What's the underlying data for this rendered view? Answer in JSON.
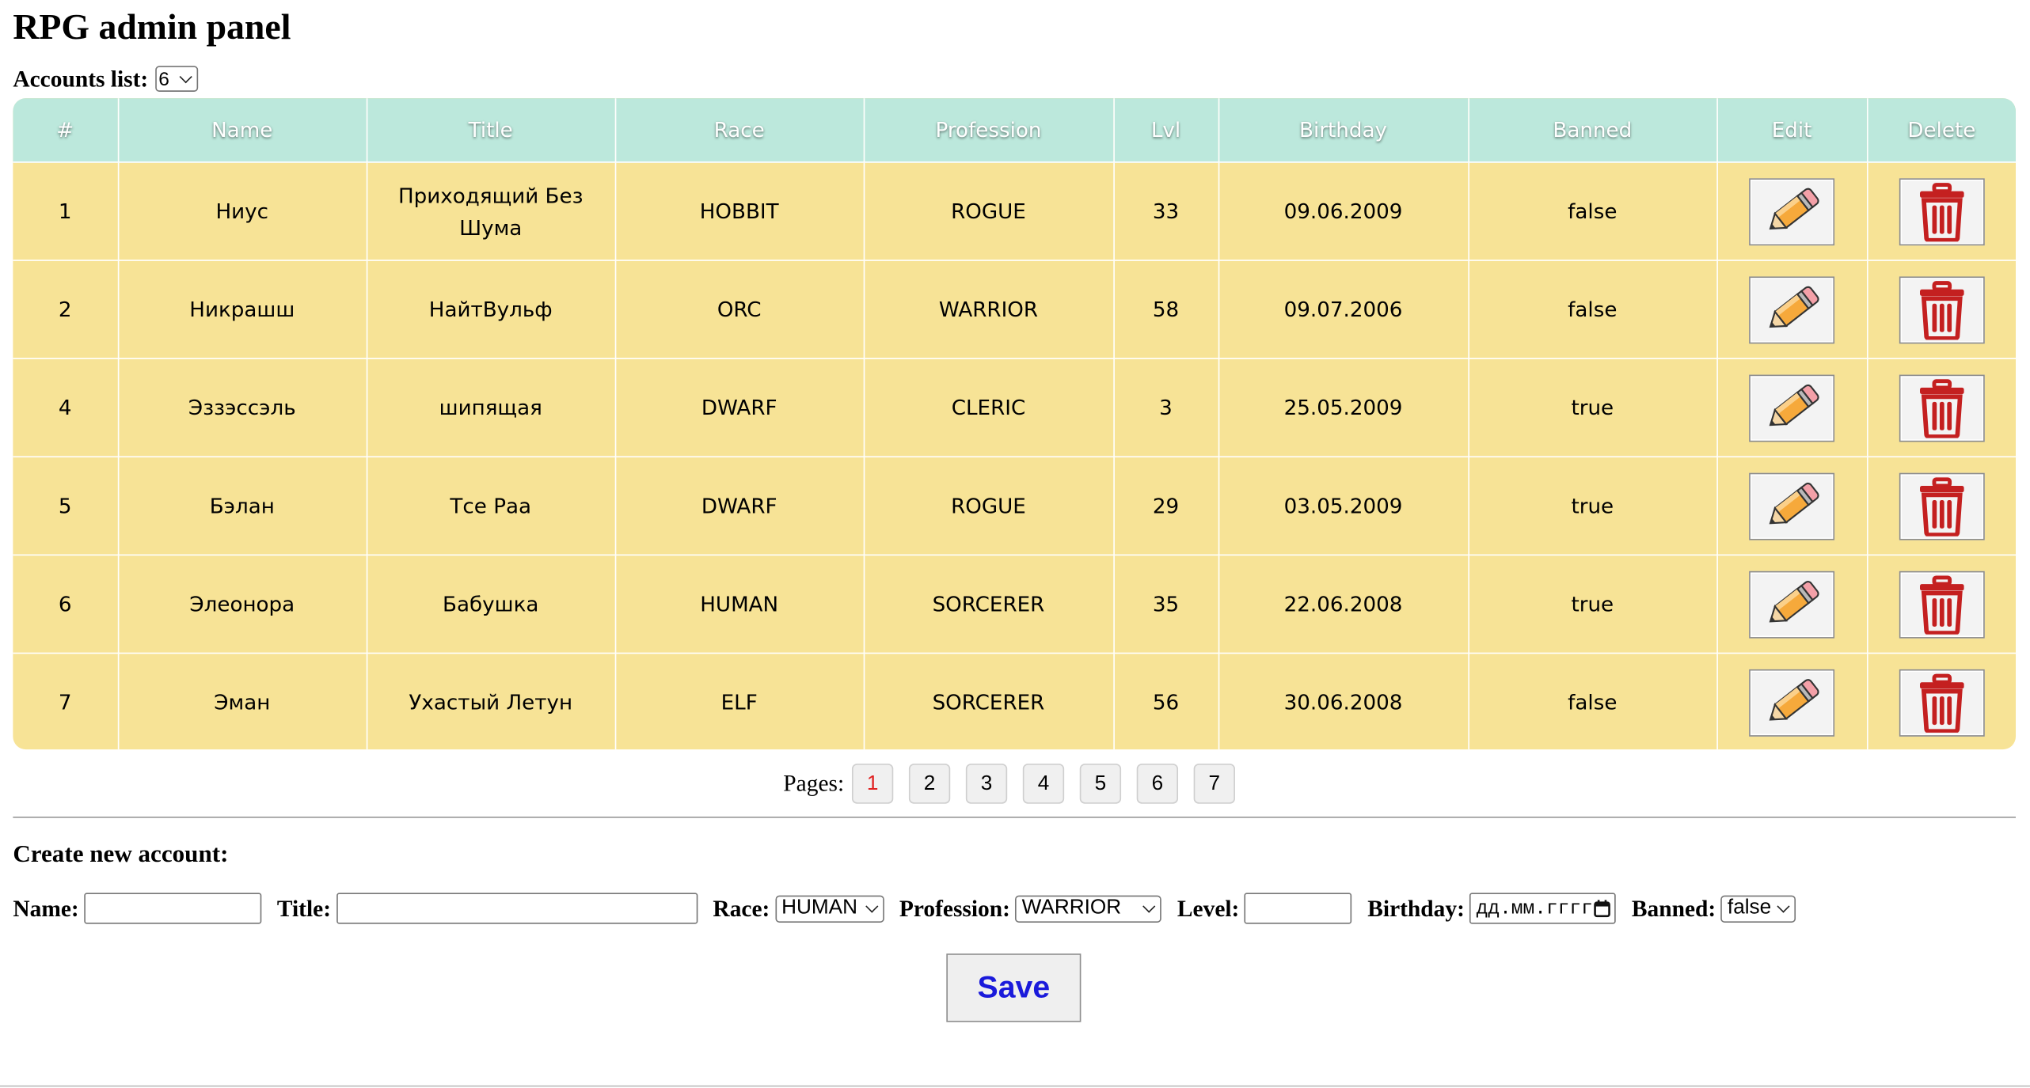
{
  "page_title": "RPG admin panel",
  "accounts": {
    "label": "Accounts list:",
    "selected": "6"
  },
  "table": {
    "headers": [
      "#",
      "Name",
      "Title",
      "Race",
      "Profession",
      "Lvl",
      "Birthday",
      "Banned",
      "Edit",
      "Delete"
    ],
    "rows": [
      {
        "id": "1",
        "name": "Ниус",
        "title": "Приходящий Без Шума",
        "race": "HOBBIT",
        "profession": "ROGUE",
        "level": "33",
        "birthday": "09.06.2009",
        "banned": "false"
      },
      {
        "id": "2",
        "name": "Никрашш",
        "title": "НайтВульф",
        "race": "ORC",
        "profession": "WARRIOR",
        "level": "58",
        "birthday": "09.07.2006",
        "banned": "false"
      },
      {
        "id": "4",
        "name": "Эззэссэль",
        "title": "шипящая",
        "race": "DWARF",
        "profession": "CLERIC",
        "level": "3",
        "birthday": "25.05.2009",
        "banned": "true"
      },
      {
        "id": "5",
        "name": "Бэлан",
        "title": "Тсе Раа",
        "race": "DWARF",
        "profession": "ROGUE",
        "level": "29",
        "birthday": "03.05.2009",
        "banned": "true"
      },
      {
        "id": "6",
        "name": "Элеонора",
        "title": "Бабушка",
        "race": "HUMAN",
        "profession": "SORCERER",
        "level": "35",
        "birthday": "22.06.2008",
        "banned": "true"
      },
      {
        "id": "7",
        "name": "Эман",
        "title": "Ухастый Летун",
        "race": "ELF",
        "profession": "SORCERER",
        "level": "56",
        "birthday": "30.06.2008",
        "banned": "false"
      }
    ],
    "edit_icon": "pencil-icon",
    "delete_icon": "trash-icon"
  },
  "pagination": {
    "label": "Pages:",
    "pages": [
      "1",
      "2",
      "3",
      "4",
      "5",
      "6",
      "7"
    ],
    "current": "1"
  },
  "create_form": {
    "heading": "Create new account:",
    "name_label": "Name:",
    "name_value": "",
    "title_label": "Title:",
    "title_value": "",
    "race_label": "Race:",
    "race_value": "HUMAN",
    "profession_label": "Profession:",
    "profession_value": "WARRIOR",
    "level_label": "Level:",
    "level_value": "",
    "birthday_label": "Birthday:",
    "birthday_placeholder": "дд.мм.гггг",
    "banned_label": "Banned:",
    "banned_value": "false",
    "save_label": "Save"
  },
  "colors": {
    "header_bg": "#bce8dc",
    "row_bg": "#f7e396",
    "active_page": "#e02020",
    "save_text": "#1a1adb"
  }
}
